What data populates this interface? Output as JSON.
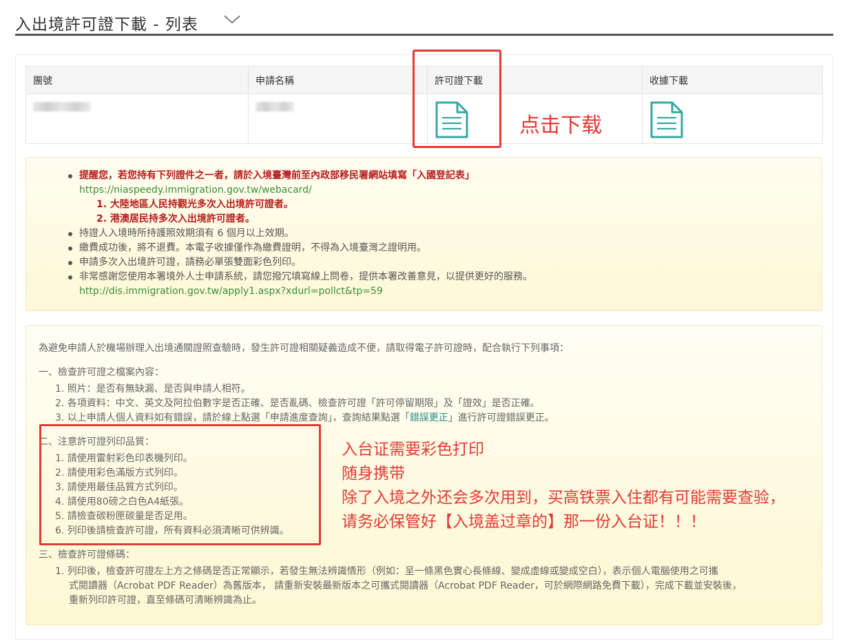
{
  "header": {
    "title": "入出境許可證下載 - 列表"
  },
  "table": {
    "columns": [
      "團號",
      "申請名稱",
      "許可證下載",
      "收據下載"
    ]
  },
  "annotations": {
    "click_download": "点击下载",
    "print_note": [
      "入台证需要彩色打印",
      "随身携带",
      "除了入境之外还会多次用到，买高铁票入住都有可能需要查验，",
      "请务必保管好【入境盖过章的】那一份入台证！！！"
    ]
  },
  "notice": {
    "reminder": "提醒您，若您持有下列證件之一者，請於入境臺灣前至內政部移民署網站填寫「入國登記表」",
    "webacard_link": "https://niaspeedy.immigration.gov.tw/webacard/",
    "sub_items": [
      "1. 大陸地區人民持觀光多次入出境許可證者。",
      "2. 港澳居民持多次入出境許可證者。"
    ],
    "items": [
      "持證人入境時所持護照效期須有 6 個月以上效期。",
      "繳費成功後，將不退費。本電子收據僅作為繳費證明，不得為入境臺灣之證明用。",
      "申請多次入出境許可證，請務必單張雙面彩色列印。",
      "非常感謝您使用本署境外人士申請系統，請您撥冗填寫線上問卷，提供本署改善意見，以提供更好的服務。"
    ],
    "survey_link": "http://dis.immigration.gov.tw/apply1.aspx?xdurl=pollct&tp=59"
  },
  "instructions": {
    "intro": "為避免申請人於機場辦理入出境通關證照查驗時，發生許可證相關疑義造成不便，請取得電子許可證時，配合執行下列事項：",
    "section1_title": "一、檢查許可證之檔案內容：",
    "section1_items": [
      "1. 照片：是否有無缺漏、是否與申請人相符。",
      "2. 各項資料：中文、英文及阿拉伯數字是否正確、是否亂碼、檢查許可證「許可停留期限」及「證效」是否正確。"
    ],
    "section1_item3_pre": "3. 以上申請人個人資料如有錯誤，請於線上點選「申請進度查詢」，查詢結果點選「",
    "section1_item3_link": "錯誤更正",
    "section1_item3_post": "」進行許可證錯誤更正。",
    "section2_title": "二、注意許可證列印品質：",
    "section2_items": [
      "1. 請使用雷射彩色印表機列印。",
      "2. 請使用彩色滿版方式列印。",
      "3. 請使用最佳品質方式列印。",
      "4. 請使用80磅之白色A4紙張。",
      "5. 請檢查碳粉匣碳量是否足用。",
      "6. 列印後請檢查許可證，所有資料必須清晰可供辨識。"
    ],
    "section3_title": "三、檢查許可證條碼：",
    "section3_lines": [
      "1. 列印後，檢查許可證左上方之條碼是否正常顯示，若發生無法辨識情形（例如：呈一條黑色實心長條線、變成虛線或變成空白），表示個人電腦使用之可攜",
      "式閱讀器（Acrobat PDF Reader）為舊版本， 請重新安裝最新版本之可攜式閱讀器（Acrobat PDF Reader，可於網際網路免費下載），完成下載並安裝後，",
      "重新列印許可證，直至條碼可清晰辨識為止。"
    ]
  }
}
